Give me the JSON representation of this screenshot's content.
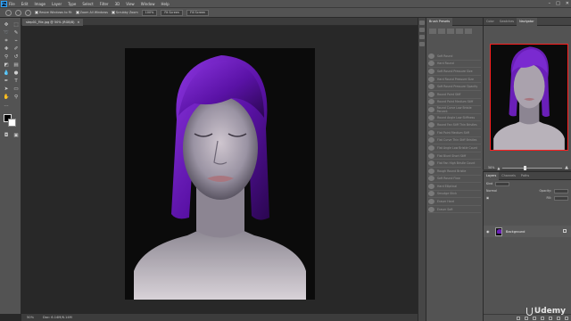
{
  "app": {
    "logo": "Ps"
  },
  "menu": [
    "File",
    "Edit",
    "Image",
    "Layer",
    "Type",
    "Select",
    "Filter",
    "3D",
    "View",
    "Window",
    "Help"
  ],
  "options_bar": {
    "resize_windows_label": "Resize Windows to Fit",
    "zoom_all_windows_label": "Zoom All Windows",
    "scrubby_zoom_label": "Scrubby Zoom",
    "btn_100": "100%",
    "fit_screen": "Fit Screen",
    "fill_screen": "Fill Screen"
  },
  "document": {
    "tab_title": "step01_File.jpg @ 50% (RGB/8)",
    "zoom_status": "50%",
    "doc_size": "Doc: 6.14M/6.14M"
  },
  "brush_panel": {
    "tabs": [
      "Brush Presets"
    ],
    "brushes": [
      "Soft Round",
      "Hard Round",
      "Soft Round Pressure Size",
      "Hard Round Pressure Size",
      "Soft Round Pressure Opacity",
      "Round Point Stiff",
      "Round Point Medium Stiff",
      "Round Curve Low Bristle Percent",
      "Round Angle Low Stiffness",
      "Round Fan Stiff Thin Bristles",
      "Flat Point Medium Stiff",
      "Flat Curve Thin Stiff Bristles",
      "Flat Angle Low Bristle Count",
      "Flat Blunt Short Stiff",
      "Flat Fan High Bristle Count",
      "Rough Round Bristle",
      "Soft Round Flow",
      "Hard Elliptical",
      "Smudge Stick",
      "Eraser Hard",
      "Eraser Soft"
    ]
  },
  "navigator": {
    "tabs": [
      "Color",
      "Swatches",
      "Navigator"
    ],
    "zoom_value": "50%"
  },
  "layers": {
    "tabs": [
      "Layers",
      "Channels",
      "Paths"
    ],
    "kind_label": "Kind",
    "mode_label": "Normal",
    "opacity_label": "Opacity:",
    "fill_label": "Fill:",
    "layer_name": "Background"
  },
  "watermark": "Udemy",
  "colors": {
    "accent_ps": "#31a8ff",
    "hair": "#6a1fb8",
    "nav_frame": "#ff2020"
  }
}
